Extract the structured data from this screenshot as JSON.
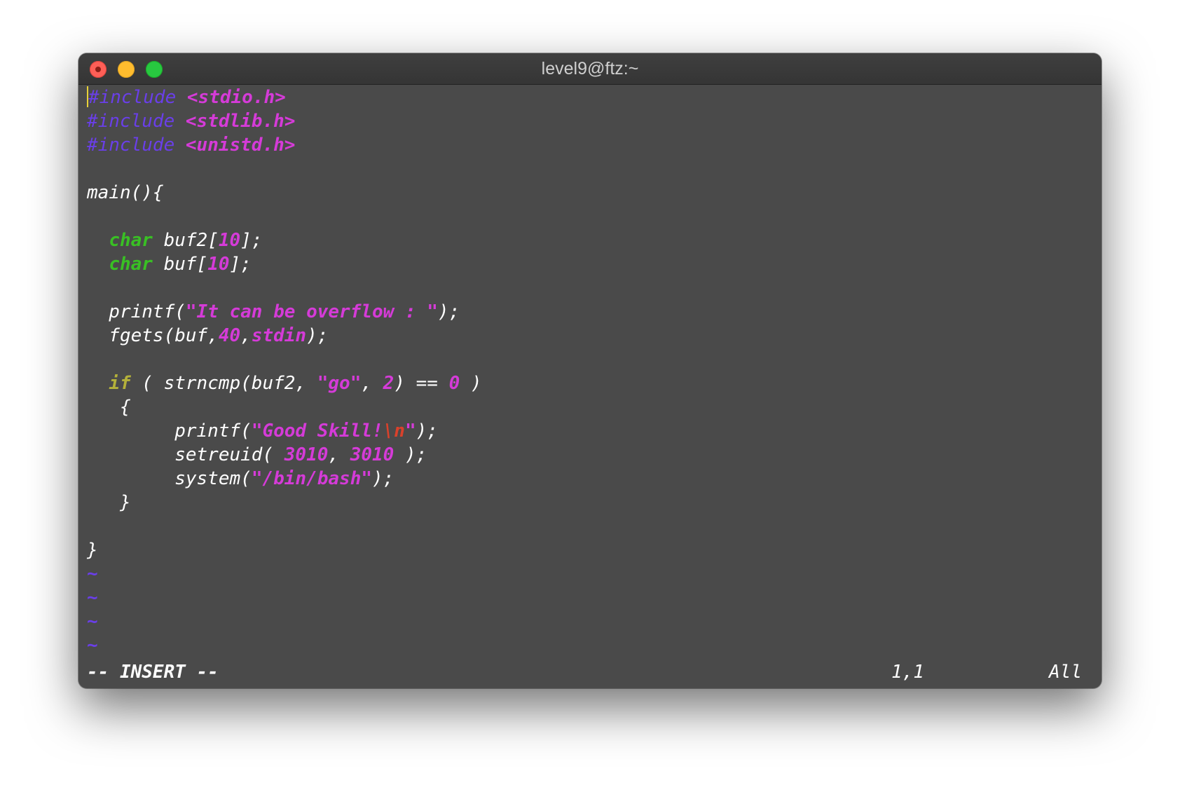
{
  "window": {
    "title": "level9@ftz:~"
  },
  "editor": {
    "lines": [
      [
        {
          "t": "#include ",
          "c": "pp"
        },
        {
          "t": "<stdio.h>",
          "c": "str"
        }
      ],
      [
        {
          "t": "#include ",
          "c": "pp"
        },
        {
          "t": "<stdlib.h>",
          "c": "str"
        }
      ],
      [
        {
          "t": "#include ",
          "c": "pp"
        },
        {
          "t": "<unistd.h>",
          "c": "str"
        }
      ],
      [],
      [
        {
          "t": "main(){",
          "c": ""
        }
      ],
      [],
      [
        {
          "t": "  ",
          "c": ""
        },
        {
          "t": "char",
          "c": "kw"
        },
        {
          "t": " buf2[",
          "c": ""
        },
        {
          "t": "10",
          "c": "num"
        },
        {
          "t": "];",
          "c": ""
        }
      ],
      [
        {
          "t": "  ",
          "c": ""
        },
        {
          "t": "char",
          "c": "kw"
        },
        {
          "t": " buf[",
          "c": ""
        },
        {
          "t": "10",
          "c": "num"
        },
        {
          "t": "];",
          "c": ""
        }
      ],
      [],
      [
        {
          "t": "  printf(",
          "c": ""
        },
        {
          "t": "\"It can be overflow : \"",
          "c": "str"
        },
        {
          "t": ");",
          "c": ""
        }
      ],
      [
        {
          "t": "  fgets(buf,",
          "c": ""
        },
        {
          "t": "40",
          "c": "num"
        },
        {
          "t": ",",
          "c": ""
        },
        {
          "t": "stdin",
          "c": "str"
        },
        {
          "t": ");",
          "c": ""
        }
      ],
      [],
      [
        {
          "t": "  ",
          "c": ""
        },
        {
          "t": "if",
          "c": "cond"
        },
        {
          "t": " ( strncmp(buf2, ",
          "c": ""
        },
        {
          "t": "\"go\"",
          "c": "str"
        },
        {
          "t": ", ",
          "c": ""
        },
        {
          "t": "2",
          "c": "num"
        },
        {
          "t": ") == ",
          "c": ""
        },
        {
          "t": "0",
          "c": "num"
        },
        {
          "t": " )",
          "c": ""
        }
      ],
      [
        {
          "t": "   {",
          "c": ""
        }
      ],
      [
        {
          "t": "        printf(",
          "c": ""
        },
        {
          "t": "\"Good Skill!",
          "c": "str"
        },
        {
          "t": "\\n",
          "c": "esc"
        },
        {
          "t": "\"",
          "c": "str"
        },
        {
          "t": ");",
          "c": ""
        }
      ],
      [
        {
          "t": "        setreuid( ",
          "c": ""
        },
        {
          "t": "3010",
          "c": "num"
        },
        {
          "t": ", ",
          "c": ""
        },
        {
          "t": "3010",
          "c": "num"
        },
        {
          "t": " );",
          "c": ""
        }
      ],
      [
        {
          "t": "        system(",
          "c": ""
        },
        {
          "t": "\"/bin/bash\"",
          "c": "str"
        },
        {
          "t": ");",
          "c": ""
        }
      ],
      [
        {
          "t": "   }",
          "c": ""
        }
      ],
      [],
      [
        {
          "t": "}",
          "c": ""
        }
      ],
      [
        {
          "t": "~",
          "c": "tilde"
        }
      ],
      [
        {
          "t": "~",
          "c": "tilde"
        }
      ],
      [
        {
          "t": "~",
          "c": "tilde"
        }
      ],
      [
        {
          "t": "~",
          "c": "tilde"
        }
      ]
    ]
  },
  "statusline": {
    "mode": "-- INSERT --",
    "position": "1,1",
    "scroll": "All"
  },
  "colors": {
    "preprocessor": "#6a3fe8",
    "string": "#d53bd8",
    "type_keyword": "#39c024",
    "conditional": "#b4b13a",
    "escape": "#d9412b",
    "background": "#4a4a4a",
    "cursor": "#e8d23a"
  }
}
